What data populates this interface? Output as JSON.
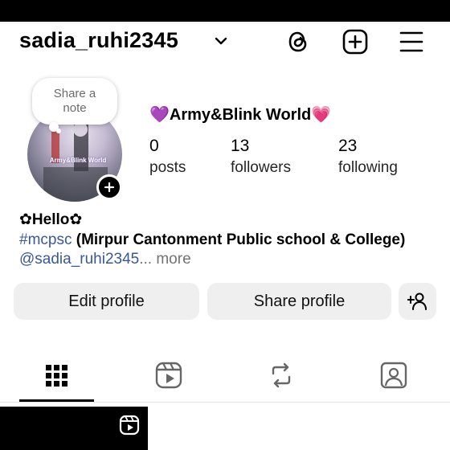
{
  "header": {
    "username": "sadia_ruhi2345",
    "icons": [
      "chevron-down-icon",
      "threads-icon",
      "new-post-icon",
      "menu-icon"
    ]
  },
  "profile": {
    "note_placeholder": "Share a note",
    "note_line1": "Share a",
    "note_line2": "note",
    "avatar_caption": "Army&Blink World",
    "display_name": "💜Army&Blink World💗",
    "stats": {
      "posts": {
        "value": "0",
        "label": "posts"
      },
      "followers": {
        "value": "13",
        "label": "followers"
      },
      "following": {
        "value": "23",
        "label": "following"
      }
    },
    "bio": {
      "title": "✿Hello✿",
      "hashtag": "#mcpsc",
      "line2_rest": " (Mirpur Cantonment Public school & College)",
      "threads_handle": "@sadia_ruhi2345",
      "more": "... more"
    }
  },
  "buttons": {
    "edit_profile": "Edit profile",
    "share_profile": "Share profile"
  },
  "tabs": [
    "grid-icon",
    "reels-icon",
    "reposts-icon",
    "tagged-icon"
  ],
  "colors": {
    "link": "#385898",
    "button_bg": "#efefef",
    "muted": "#737373"
  }
}
